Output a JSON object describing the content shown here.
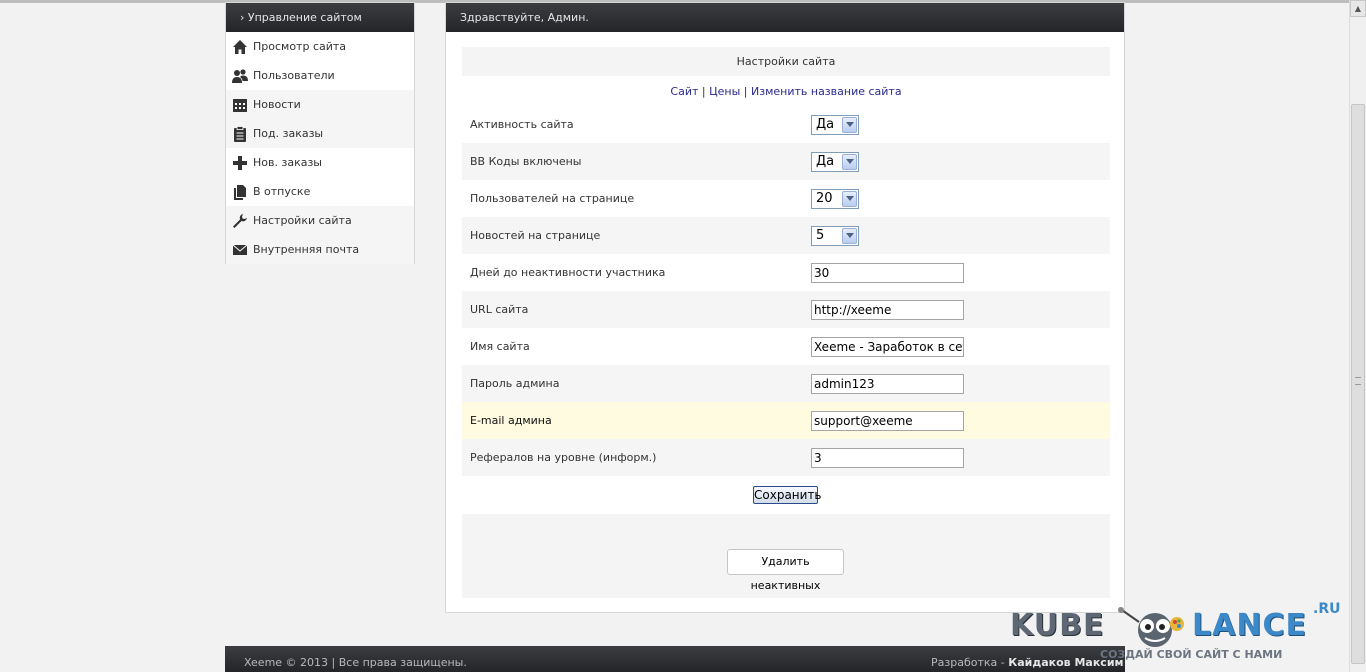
{
  "sidebar": {
    "title": "› Управление сайтом",
    "items": [
      {
        "label": "Просмотр сайта",
        "icon": "home-icon"
      },
      {
        "label": "Пользователи",
        "icon": "users-icon"
      },
      {
        "label": "Новости",
        "icon": "calendar-icon"
      },
      {
        "label": "Под. заказы",
        "icon": "clipboard-icon"
      },
      {
        "label": "Нов. заказы",
        "icon": "plus-icon"
      },
      {
        "label": "В отпуске",
        "icon": "documents-icon"
      },
      {
        "label": "Настройки сайта",
        "icon": "wrench-icon"
      },
      {
        "label": "Внутренняя почта",
        "icon": "mail-icon"
      }
    ]
  },
  "header": {
    "greeting": "Здравствуйте, Админ."
  },
  "settings": {
    "title": "Настройки сайта",
    "links": {
      "site": "Сайт",
      "sep1": " | ",
      "prices": "Цены",
      "sep2": " | ",
      "rename": "Изменить название сайта"
    },
    "fields": [
      {
        "label": "Активность сайта",
        "type": "select",
        "value": "Да"
      },
      {
        "label": "BB Коды включены",
        "type": "select",
        "value": "Да"
      },
      {
        "label": "Пользователей на странице",
        "type": "select",
        "value": "20"
      },
      {
        "label": "Новостей на странице",
        "type": "select",
        "value": "5"
      },
      {
        "label": "Дней до неактивности участника",
        "type": "input",
        "value": "30"
      },
      {
        "label": "URL сайта",
        "type": "input",
        "value": "http://xeeme"
      },
      {
        "label": "Имя сайта",
        "type": "input",
        "value": "Xeeme - Заработок в сети"
      },
      {
        "label": "Пароль админа",
        "type": "input",
        "value": "admin123"
      },
      {
        "label": "E-mail админа",
        "type": "input",
        "value": "support@xeeme"
      },
      {
        "label": "Рефералов на уровне (информ.)",
        "type": "input",
        "value": "3"
      }
    ],
    "save_label": "Сохранить",
    "delete_label": "Удалить неактивных"
  },
  "footer": {
    "copyright": "Xeeme © 2013 | Все права защищены.",
    "dev_prefix": "Разработка - ",
    "dev_name": "Кайдаков Максим"
  },
  "watermark": {
    "kube": "KUBE",
    "lance": "LANCE",
    "ru": ".RU",
    "slogan": "СОЗДАЙ СВОЙ САЙТ С НАМИ"
  },
  "colors": {
    "header_bg": "#2d2f33",
    "highlight_row": "#fffbe0",
    "link": "#2a2a8c"
  }
}
